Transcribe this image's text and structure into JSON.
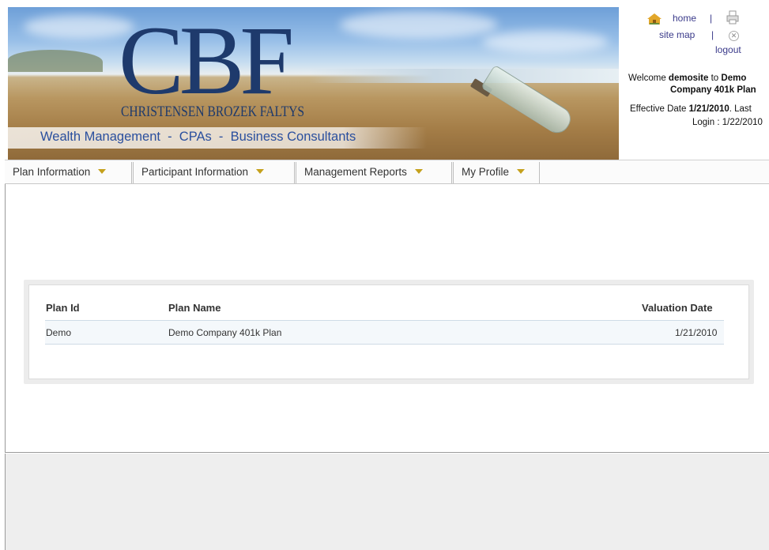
{
  "header": {
    "logo_letters": "CBF",
    "firm_name": "CHRISTENSEN BROZEK FALTYS",
    "tagline": "Wealth Management  -  CPAs  -  Business Consultants"
  },
  "util_links": {
    "home": "home",
    "sep": "|",
    "site_map": "site map",
    "logout": "logout"
  },
  "user_info": {
    "welcome_prefix": "Welcome ",
    "username": "demosite",
    "welcome_to": " to ",
    "plan_part1": "Demo",
    "plan_part2": "Company 401k Plan",
    "effective_prefix": "Effective Date ",
    "effective_date": "1/21/2010",
    "effective_suffix": ". Last",
    "login_line": "Login : 1/22/2010"
  },
  "menu": {
    "items": [
      {
        "label": "Plan Information"
      },
      {
        "label": "Participant Information"
      },
      {
        "label": "Management Reports"
      },
      {
        "label": "My Profile"
      }
    ]
  },
  "plans_table": {
    "columns": [
      "Plan Id",
      "Plan Name",
      "Valuation Date"
    ],
    "rows": [
      {
        "plan_id": "Demo",
        "plan_name": "Demo Company 401k Plan",
        "valuation_date": "1/21/2010"
      }
    ]
  },
  "colors": {
    "brand_navy": "#1e3a6c",
    "tagline_blue": "#2a4f9e",
    "link_color": "#3a3a8a",
    "menu_arrow": "#c5a11c"
  },
  "icons": {
    "home": "home-icon",
    "print": "print-icon",
    "logout": "logout-icon",
    "menu_arrow": "dropdown-arrow-icon"
  }
}
